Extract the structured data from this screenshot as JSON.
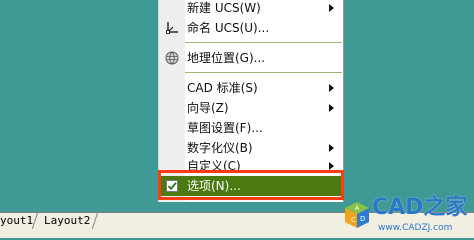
{
  "menu": {
    "items": [
      {
        "label": "新建 UCS(W)",
        "has_submenu": true,
        "icon": ""
      },
      {
        "label": "命名 UCS(U)...",
        "has_submenu": false,
        "icon": "ucs-icon"
      },
      {
        "label": "地理位置(G)...",
        "has_submenu": false,
        "icon": "globe-icon"
      },
      {
        "label": "CAD 标准(S)",
        "has_submenu": true,
        "icon": ""
      },
      {
        "label": "向导(Z)",
        "has_submenu": true,
        "icon": ""
      },
      {
        "label": "草图设置(F)...",
        "has_submenu": false,
        "icon": ""
      },
      {
        "label": "数字化仪(B)",
        "has_submenu": true,
        "icon": ""
      },
      {
        "label": "自定义(C)",
        "has_submenu": true,
        "icon": ""
      },
      {
        "label": "选项(N)...",
        "has_submenu": false,
        "icon": "checkbox-icon",
        "selected": true
      }
    ],
    "colors": {
      "selected_bg": "#4b7a10",
      "highlight_border": "#ff3b12",
      "workspace_bg": "#3f9a95"
    }
  },
  "tabs": {
    "items": [
      {
        "label": "yout1"
      },
      {
        "label": "Layout2"
      }
    ]
  },
  "watermark": {
    "title": "CAD之家",
    "url": "www.CADZJ.com",
    "logo_icon": "cad-cube-logo-icon"
  }
}
